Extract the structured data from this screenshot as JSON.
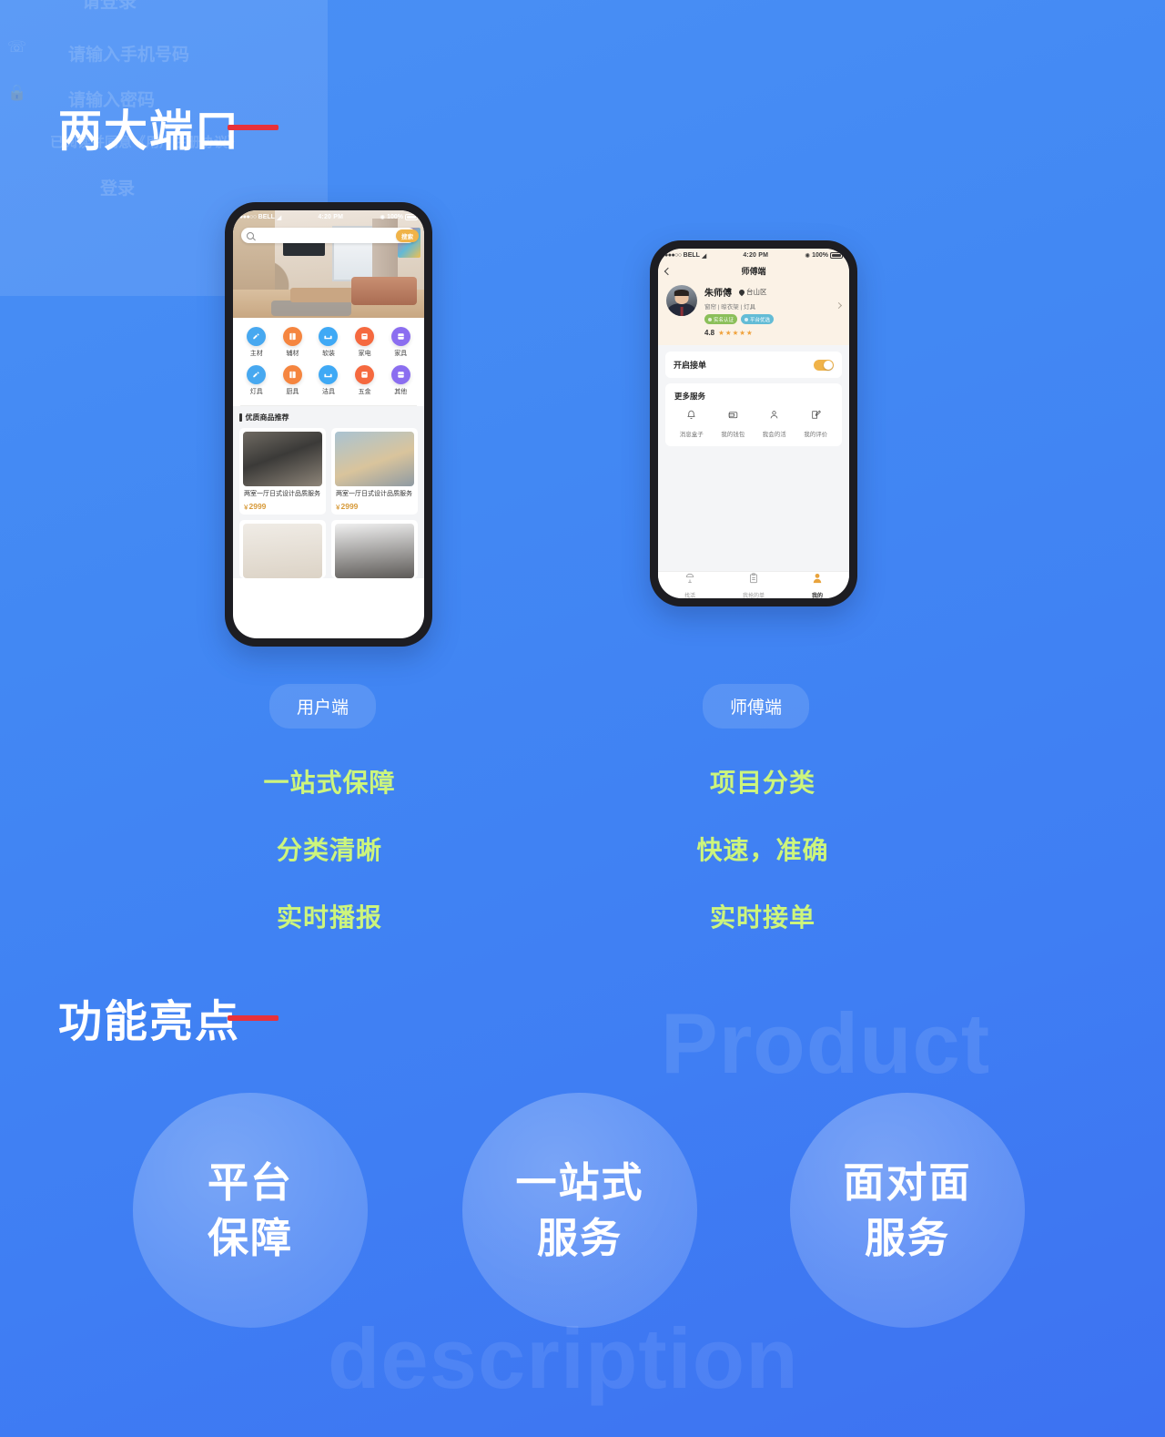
{
  "sections": {
    "ports_title": "两大端口",
    "feature_title": "功能亮点"
  },
  "watermarks": {
    "product": "Product",
    "description": "description",
    "ghost": {
      "login_title": "请登录",
      "phone_placeholder": "请输入手机号码",
      "password_placeholder": "请输入密码",
      "agreement": "已阅读并同意《用户注册协议》",
      "submit": "登录"
    }
  },
  "phones": {
    "user": {
      "status": {
        "carrier": "BELL",
        "dots": "●●●○○",
        "time": "4:20 PM",
        "battery": "100%"
      },
      "search": {
        "placeholder": "",
        "button": "搜索",
        "icon": "search-icon"
      },
      "categories": [
        {
          "label": "主材",
          "color": "#47a8f0",
          "icon": "faucet-icon"
        },
        {
          "label": "辅材",
          "color": "#f5853f",
          "icon": "board-icon"
        },
        {
          "label": "软装",
          "color": "#3fa9f5",
          "icon": "sofa-icon"
        },
        {
          "label": "家电",
          "color": "#f5693f",
          "icon": "appliance-icon"
        },
        {
          "label": "家具",
          "color": "#8b6ef0",
          "icon": "cabinet-icon"
        },
        {
          "label": "灯具",
          "color": "#47a8f0",
          "icon": "lamp-icon"
        },
        {
          "label": "厨具",
          "color": "#f5853f",
          "icon": "kitchen-icon"
        },
        {
          "label": "洁具",
          "color": "#3fa9f5",
          "icon": "bath-icon"
        },
        {
          "label": "五金",
          "color": "#f5693f",
          "icon": "hardware-icon"
        },
        {
          "label": "其他",
          "color": "#8b6ef0",
          "icon": "more-icon"
        }
      ],
      "recommend_title": "优质商品推荐",
      "products": [
        {
          "name": "两室一厅日式设计品质服务",
          "currency": "￥",
          "price": "2999"
        },
        {
          "name": "两室一厅日式设计品质服务",
          "currency": "￥",
          "price": "2999"
        }
      ]
    },
    "master": {
      "status": {
        "carrier": "BELL",
        "dots": "●●●○○",
        "time": "4:20 PM",
        "battery": "100%"
      },
      "nav_title": "师傅端",
      "profile": {
        "name": "朱师傅",
        "location": "台山区",
        "skills": "窗帘 | 晾衣架 | 灯具",
        "badges": [
          {
            "text": "实名认证",
            "color": "#8bbf5a"
          },
          {
            "text": "平台优选",
            "color": "#63bcd6"
          }
        ],
        "rating": "4.8",
        "stars": "★★★★★"
      },
      "accept_orders": {
        "label": "开启接单",
        "state": "on"
      },
      "more_services_title": "更多服务",
      "services": [
        {
          "label": "消息盒子",
          "icon": "bell-icon"
        },
        {
          "label": "我的钱包",
          "icon": "wallet-icon"
        },
        {
          "label": "我会的活",
          "icon": "person-icon"
        },
        {
          "label": "我的评价",
          "icon": "edit-icon"
        }
      ],
      "tabs": [
        {
          "label": "找活",
          "icon": "search-job-icon",
          "active": false
        },
        {
          "label": "我抢的单",
          "icon": "clipboard-icon",
          "active": false
        },
        {
          "label": "我的",
          "icon": "user-icon",
          "active": true
        }
      ]
    }
  },
  "pills": {
    "user": "用户端",
    "master": "师傅端"
  },
  "feature_lists": {
    "user": [
      "一站式保障",
      "分类清晰",
      "实时播报"
    ],
    "master": [
      "项目分类",
      "快速，准确",
      "实时接单"
    ]
  },
  "highlight_circles": [
    {
      "line1": "平台",
      "line2": "保障"
    },
    {
      "line1": "一站式",
      "line2": "服务"
    },
    {
      "line1": "面对面",
      "line2": "服务"
    }
  ],
  "colors": {
    "background_from": "#4a90f5",
    "background_to": "#3d72f2",
    "accent_red": "#e8313a",
    "feature_green": "#cdf57c",
    "toggle_orange": "#f0b349"
  }
}
